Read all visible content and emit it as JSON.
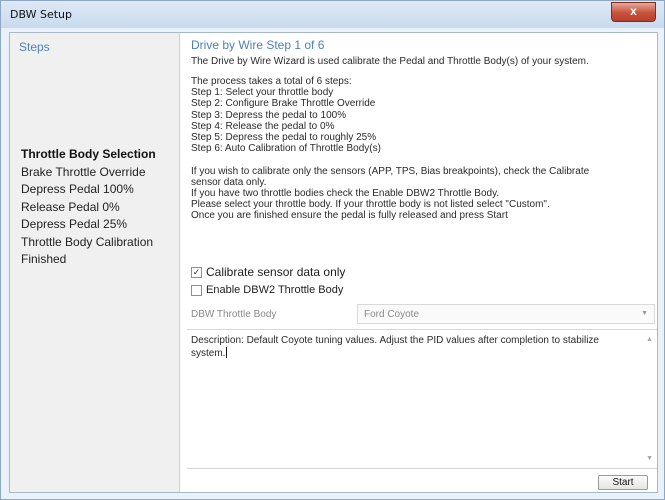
{
  "window": {
    "title": "DBW Setup",
    "close_glyph": "x"
  },
  "sidebar": {
    "title": "Steps",
    "items": [
      {
        "label": "Throttle Body Selection",
        "active": true
      },
      {
        "label": "Brake Throttle Override"
      },
      {
        "label": "Depress Pedal 100%"
      },
      {
        "label": "Release Pedal 0%"
      },
      {
        "label": "Depress Pedal 25%"
      },
      {
        "label": "Throttle Body Calibration"
      },
      {
        "label": "Finished"
      }
    ]
  },
  "main": {
    "step_title": "Drive by Wire Step 1 of 6",
    "intro": "The Drive by Wire Wizard is used calibrate the Pedal and Throttle Body(s) of your system.",
    "instructions": [
      "The process takes a total of 6 steps:",
      "Step 1: Select your throttle body",
      "Step 2: Configure Brake Throttle Override",
      "Step 3: Depress the pedal to 100%",
      "Step 4: Release the pedal to 0%",
      "Step 5: Depress the pedal to roughly 25%",
      "Step 6: Auto Calibration of Throttle Body(s)",
      "",
      "If you wish to calibrate only the sensors (APP, TPS, Bias breakpoints), check the Calibrate",
      "sensor data only.",
      "If you have two throttle bodies check the Enable DBW2 Throttle Body.",
      "Please select your throttle body. If your throttle body is not listed select \"Custom\".",
      "Once you are finished ensure the pedal is fully released and press Start"
    ],
    "calibrate_only": {
      "label": "Calibrate sensor data only",
      "checked": true
    },
    "enable_dbw2": {
      "label": "Enable DBW2 Throttle Body",
      "checked": false
    },
    "throttle_body": {
      "label": "DBW Throttle Body",
      "value": "Ford Coyote"
    },
    "description": "Description: Default Coyote tuning values. Adjust the PID values after completion to stabilize system.",
    "start_label": "Start"
  }
}
